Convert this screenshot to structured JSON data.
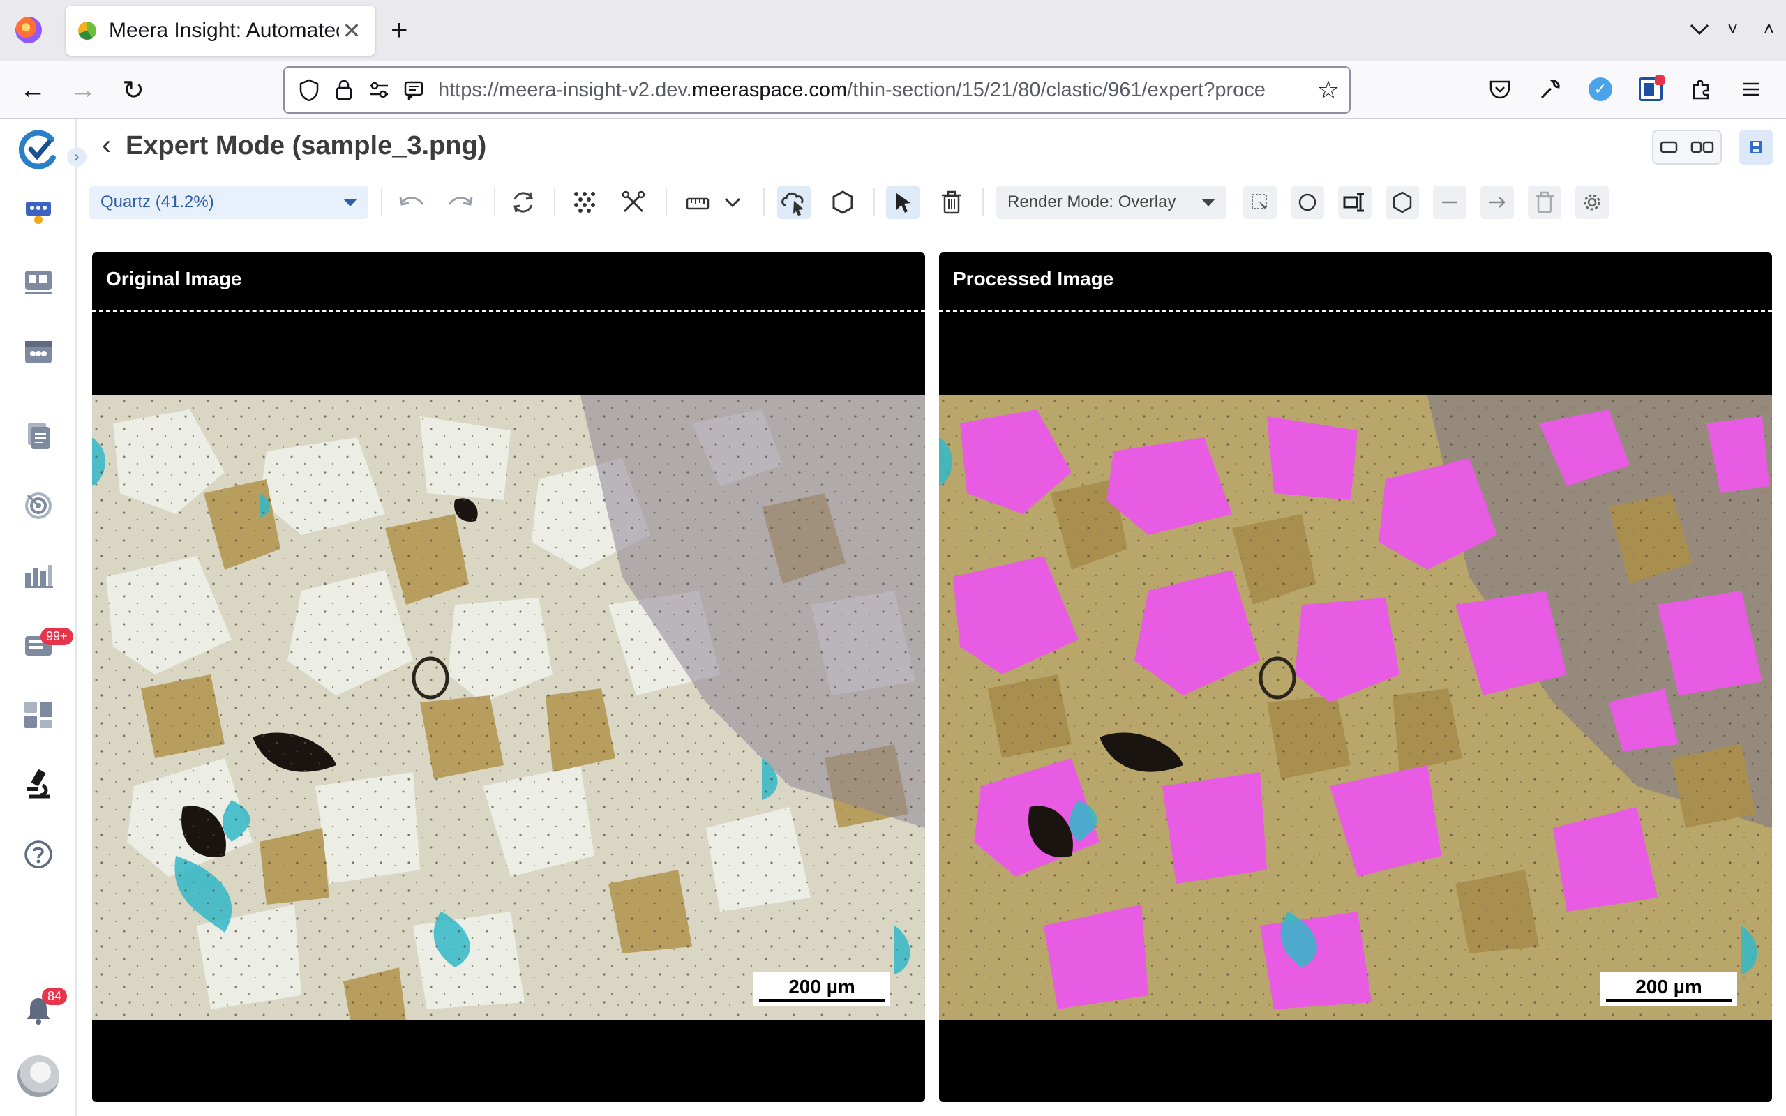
{
  "browser": {
    "tab_title": "Meera Insight: Automated",
    "url_prefix": "https://meera-insight-v2.dev.",
    "url_domain": "meeraspace.com",
    "url_suffix": "/thin-section/15/21/80/clastic/961/expert?proce"
  },
  "sidebar": {
    "report_badge": "99+",
    "notification_badge": "84"
  },
  "header": {
    "title": "Expert Mode (sample_3.png)"
  },
  "toolbar": {
    "class_select_value": "Quartz (41.2%)",
    "render_mode_value": "Render Mode: Overlay"
  },
  "panels": {
    "original_title": "Original Image",
    "processed_title": "Processed Image",
    "scale_label": "200 µm",
    "overlay_color": "#e85be3"
  }
}
